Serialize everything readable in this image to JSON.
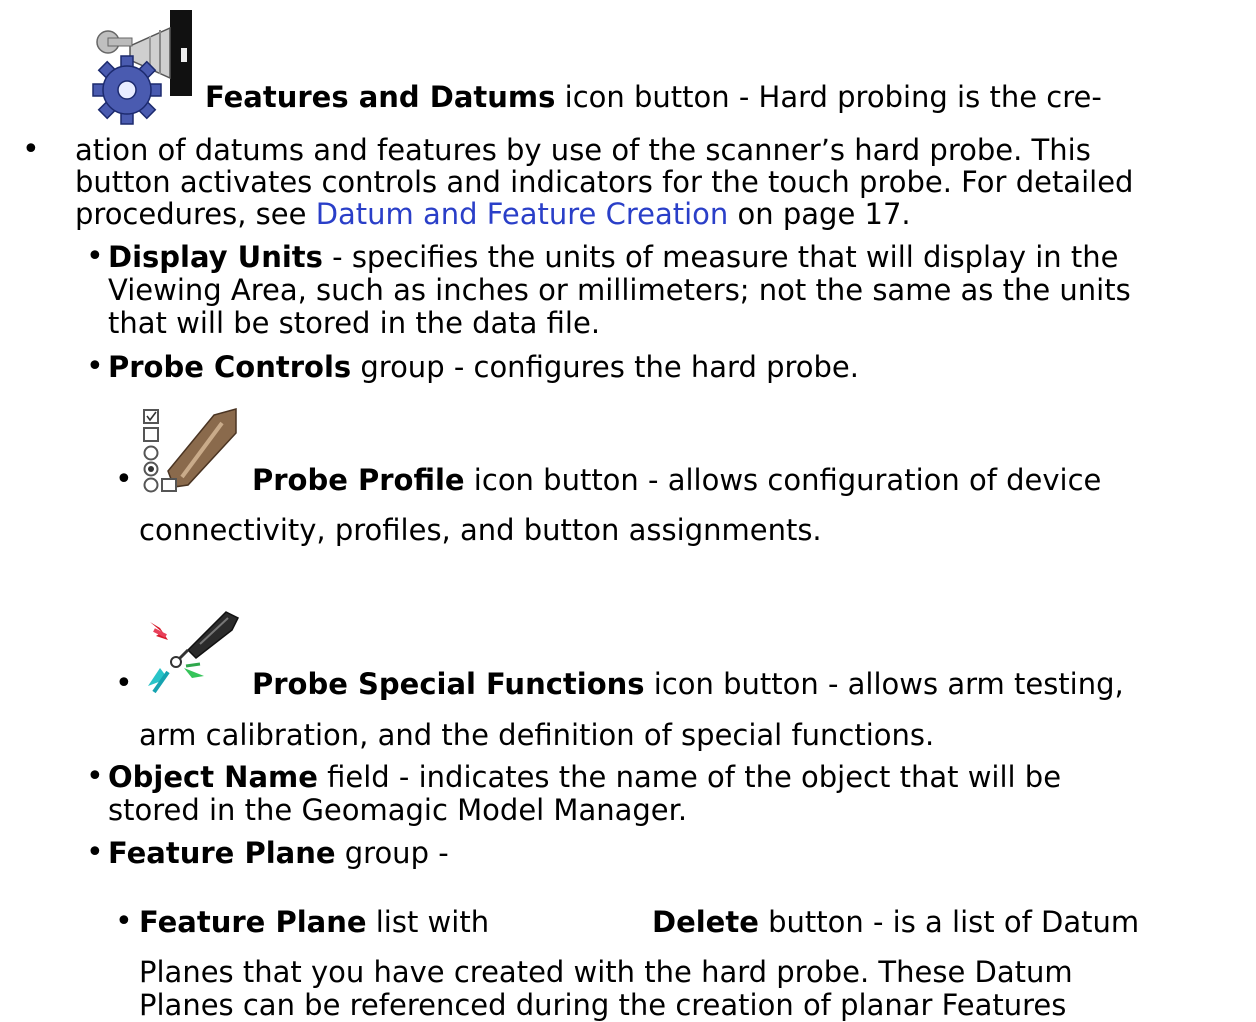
{
  "colors": {
    "link": "#2a3fc8",
    "text": "#000000"
  },
  "icons": [
    "scanner-gear-icon",
    "probe-profile-icon",
    "probe-special-functions-icon"
  ],
  "features_datums": {
    "name": "Features and Datums",
    "suffix": " icon button - Hard probing is the cre-",
    "line2": "ation of datums and features by use of the scanner’s hard probe. This",
    "line3": "button activates controls and indicators for the touch probe. For detailed",
    "line4_pre": "procedures, see ",
    "link": "Datum and Feature Creation",
    "line4_post": " on page 17."
  },
  "display_units": {
    "name": "Display Units",
    "line1": " - specifies the units of measure that will display in the",
    "line2": "Viewing Area, such as inches or millimeters; not the same as the units",
    "line3": "that will be stored in the data file."
  },
  "probe_controls": {
    "name": "Probe Controls",
    "rest": " group - configures the hard probe."
  },
  "probe_profile": {
    "name": "Probe Profile",
    "line1": " icon button - allows configuration of device",
    "line2": "connectivity, profiles, and button assignments."
  },
  "probe_special": {
    "name": "Probe Special Functions",
    "line1": " icon button - allows arm testing,",
    "line2": "arm calibration, and the definition of special functions."
  },
  "object_name": {
    "name": "Object Name",
    "line1": " field - indicates the name of the object that will be",
    "line2": "stored in the Geomagic Model Manager."
  },
  "feature_plane_group": {
    "name": "Feature Plane",
    "rest": " group -"
  },
  "feature_plane_list": {
    "name": "Feature Plane",
    "mid": " list with",
    "delete": "Delete",
    "line1_end": " button - is a list of Datum",
    "line2": "Planes that you have created with the hard probe. These Datum",
    "line3": "Planes can be referenced during the creation of planar Features"
  },
  "bullet": "•"
}
